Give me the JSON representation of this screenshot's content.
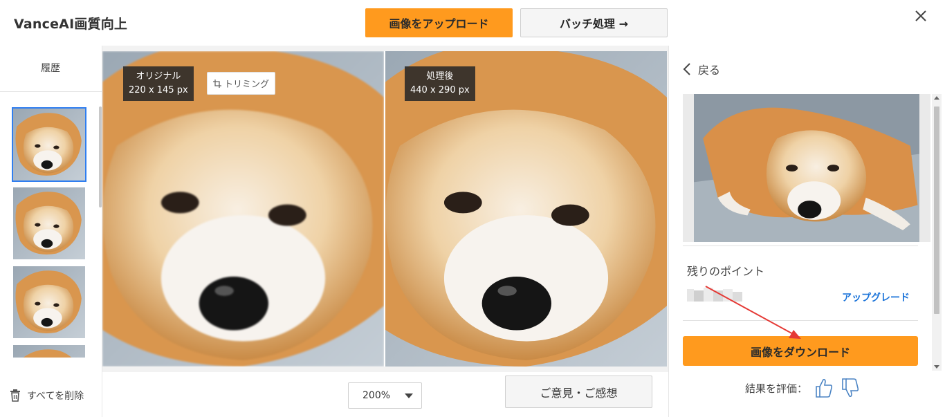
{
  "header": {
    "title": "VanceAI画質向上",
    "upload_label": "画像をアップロード",
    "batch_label": "バッチ処理 →"
  },
  "history": {
    "label": "履歴",
    "delete_all_label": "すべてを削除"
  },
  "compare": {
    "original_label": "オリジナル",
    "original_size": "220 x 145 px",
    "processed_label": "処理後",
    "processed_size": "440 x 290 px",
    "trim_label": "トリミング",
    "zoom_value": "200%",
    "feedback_label": "ご意見・ご感想"
  },
  "side": {
    "back_label": "戻る",
    "points_label": "残りのポイント",
    "upgrade_label": "アップグレード",
    "download_label": "画像をダウンロード",
    "rate_label": "結果を評価："
  },
  "colors": {
    "accent": "#ff9a1e",
    "link": "#1a73d9",
    "selected_outline": "#2f7ef0",
    "annotation_arrow": "#e53935"
  },
  "icons": {
    "close": "close-icon",
    "trash": "trash-icon",
    "back": "chevron-left-icon",
    "crop": "crop-icon",
    "thumbs_up": "thumbs-up-icon",
    "thumbs_down": "thumbs-down-icon"
  }
}
